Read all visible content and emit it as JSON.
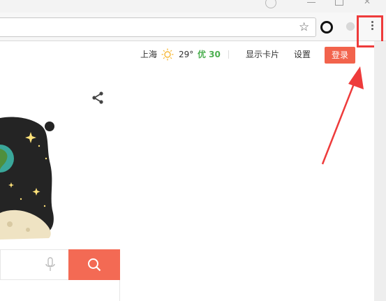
{
  "header": {
    "city": "上海",
    "weather_icon": "sun-icon",
    "temperature": "29°",
    "air_quality": "优 30",
    "show_cards": "显示卡片",
    "settings": "设置",
    "login": "登录"
  },
  "toolbar": {
    "icons": [
      "star-icon",
      "extension-circle-icon",
      "extension-gray-icon",
      "menu-dots-icon"
    ]
  },
  "annotation": {
    "color": "#ee3b3b"
  },
  "search": {
    "button_color": "#f36a54",
    "icons": [
      "microphone-icon",
      "search-icon"
    ]
  },
  "colors": {
    "login_bg": "#f2634c",
    "aqi_good": "#4caf50"
  }
}
